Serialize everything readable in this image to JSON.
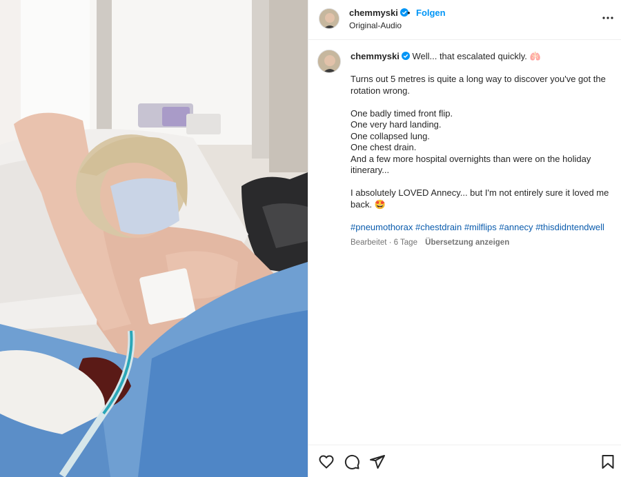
{
  "post": {
    "username": "chemmyski",
    "follow_label": "Folgen",
    "separator": "•",
    "audio_label": "Original-Audio"
  },
  "caption": {
    "username": "chemmyski",
    "first_line": "Well... that escalated quickly. 🫁",
    "para1": "Turns out 5 metres is quite a long way to discover you've got the rotation wrong.",
    "lines": [
      "One badly timed front flip.",
      "One very hard landing.",
      "One collapsed lung.",
      "One chest drain.",
      "And a few more hospital overnights than were on the holiday itinerary..."
    ],
    "para3": "I absolutely LOVED Annecy... but I'm not entirely sure it loved me back. 🤩",
    "hashtags": [
      "#pneumothorax",
      "#chestdrain",
      "#milflips",
      "#annecy",
      "#thisdidntendwell"
    ]
  },
  "meta": {
    "edited": "Bearbeitet · 6 Tage",
    "translate_label": "Übersetzung anzeigen"
  },
  "icons": {
    "like": "heart-icon",
    "comment": "comment-icon",
    "share": "paper-plane-icon",
    "save": "bookmark-icon",
    "more": "more-horizontal-icon",
    "verified": "verified-badge-icon"
  },
  "colors": {
    "accent": "#0095f6",
    "verified": "#0095f6",
    "hashtag": "#0b5cad",
    "muted": "#737373",
    "text": "#262626"
  }
}
